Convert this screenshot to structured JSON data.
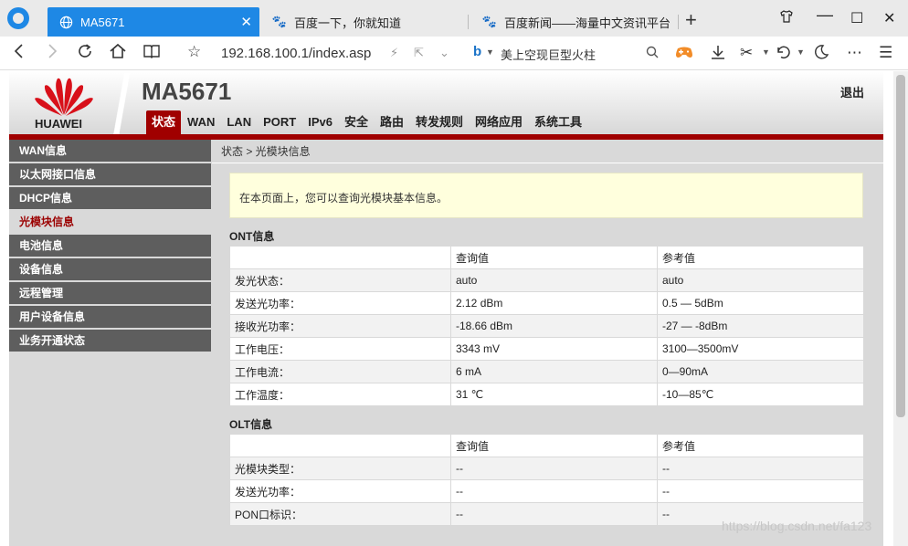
{
  "browser": {
    "tabs": [
      {
        "title": "MA5671",
        "active": true
      },
      {
        "title": "百度一下，你就知道",
        "active": false
      },
      {
        "title": "百度新闻——海量中文资讯平台",
        "active": false
      }
    ],
    "address": "192.168.100.1/index.asp",
    "search_suggestion": "美上空现巨型火柱",
    "accent_color": "#1e88e5"
  },
  "router": {
    "brand": "HUAWEI",
    "model": "MA5671",
    "logout": "退出",
    "nav": [
      "状态",
      "WAN",
      "LAN",
      "PORT",
      "IPv6",
      "安全",
      "路由",
      "转发规则",
      "网络应用",
      "系统工具"
    ],
    "nav_active": 0,
    "accent_color": "#a00000",
    "sidebar": [
      "WAN信息",
      "以太网接口信息",
      "DHCP信息",
      "光模块信息",
      "电池信息",
      "设备信息",
      "远程管理",
      "用户设备信息",
      "业务开通状态"
    ],
    "sidebar_active": 3,
    "breadcrumb": "状态 > 光模块信息",
    "notice": "在本页面上，您可以查询光模块基本信息。",
    "ont": {
      "title": "ONT信息",
      "headers": [
        "",
        "查询值",
        "参考值"
      ],
      "rows": [
        [
          "发光状态：",
          "auto",
          "auto"
        ],
        [
          "发送光功率：",
          "2.12 dBm",
          "0.5 — 5dBm"
        ],
        [
          "接收光功率：",
          "-18.66 dBm",
          "-27 — -8dBm"
        ],
        [
          "工作电压：",
          "3343 mV",
          "3100—3500mV"
        ],
        [
          "工作电流：",
          "6 mA",
          "0—90mA"
        ],
        [
          "工作温度：",
          "31 ℃",
          "-10—85℃"
        ]
      ]
    },
    "olt": {
      "title": "OLT信息",
      "headers": [
        "",
        "查询值",
        "参考值"
      ],
      "rows": [
        [
          "光模块类型：",
          "--",
          "--"
        ],
        [
          "发送光功率：",
          "--",
          "--"
        ],
        [
          "PON口标识：",
          "--",
          "--"
        ]
      ]
    }
  },
  "watermark": "https://blog.csdn.net/fa123"
}
